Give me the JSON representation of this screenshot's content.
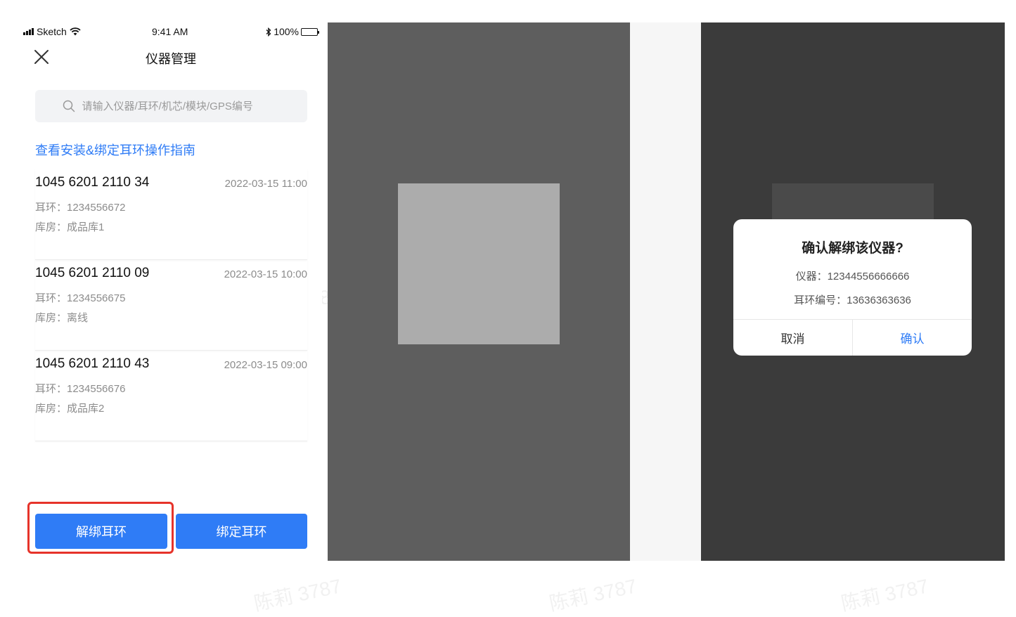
{
  "status_bar": {
    "carrier": "Sketch",
    "time": "9:41 AM",
    "battery": "100%"
  },
  "nav": {
    "title": "仪器管理"
  },
  "search": {
    "placeholder": "请输入仪器/耳环/机芯/模块/GPS编号"
  },
  "guide_link": "查看安装&绑定耳环操作指南",
  "devices": [
    {
      "number": "1045 6201 2110 34",
      "time": "2022-03-15 11:00",
      "ear_tag": "耳环：1234556672",
      "warehouse": "库房：成品库1"
    },
    {
      "number": "1045 6201 2110 09",
      "time": "2022-03-15 10:00",
      "ear_tag": "耳环：1234556675",
      "warehouse": "库房：离线"
    },
    {
      "number": "1045 6201 2110 43",
      "time": "2022-03-15 09:00",
      "ear_tag": "耳环：1234556676",
      "warehouse": "库房：成品库2"
    }
  ],
  "buttons": {
    "unbind": "解绑耳环",
    "bind": "绑定耳环"
  },
  "dialog": {
    "title": "确认解绑该仪器?",
    "device_line": "仪器：12344556666666",
    "ear_tag_line": "耳环编号：13636363636",
    "cancel": "取消",
    "confirm": "确认"
  },
  "watermark": "陈莉 3787",
  "colors": {
    "accent": "#2f7cf6",
    "highlight": "#e6332a"
  }
}
